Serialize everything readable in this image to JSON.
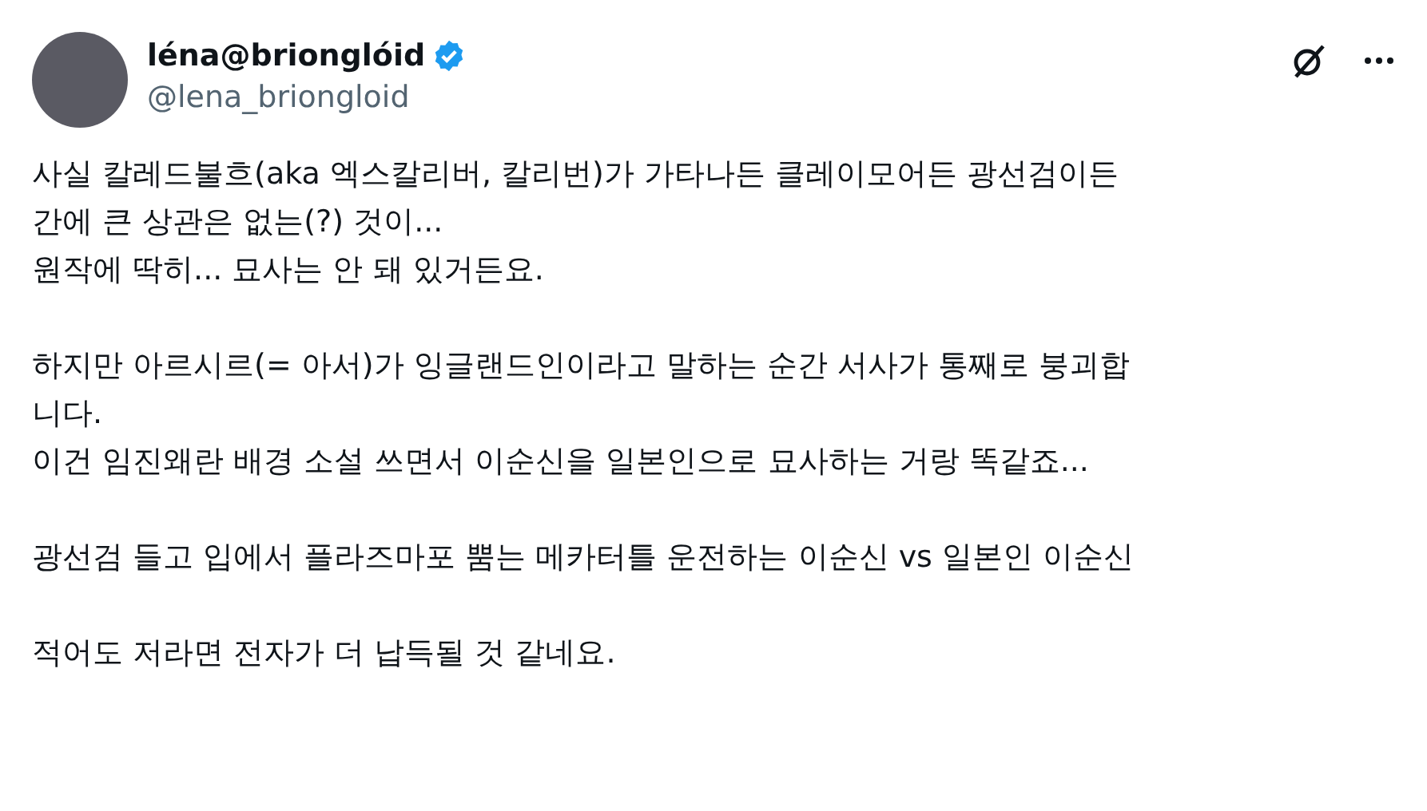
{
  "author": {
    "name": "léna@brionglóid",
    "handle": "@lena_briongloid",
    "verified": true
  },
  "paragraphs": [
    [
      "사실 칼레드불흐(aka 엑스칼리버, 칼리번)가 가타나든 클레이모어든 광선검이든",
      "간에 큰 상관은 없는(?) 것이...",
      "원작에 딱히... 묘사는 안 돼 있거든요."
    ],
    [
      "하지만 아르시르(= 아서)가 잉글랜드인이라고 말하는 순간 서사가 통째로 붕괴합",
      "니다.",
      "이건 임진왜란 배경 소설 쓰면서 이순신을 일본인으로 묘사하는 거랑 똑같죠..."
    ],
    [
      "광선검 들고 입에서 플라즈마포 뿜는 메카터틀 운전하는 이순신 vs 일본인 이순신"
    ],
    [
      "적어도 저라면 전자가 더 납득될 것 같네요."
    ]
  ]
}
